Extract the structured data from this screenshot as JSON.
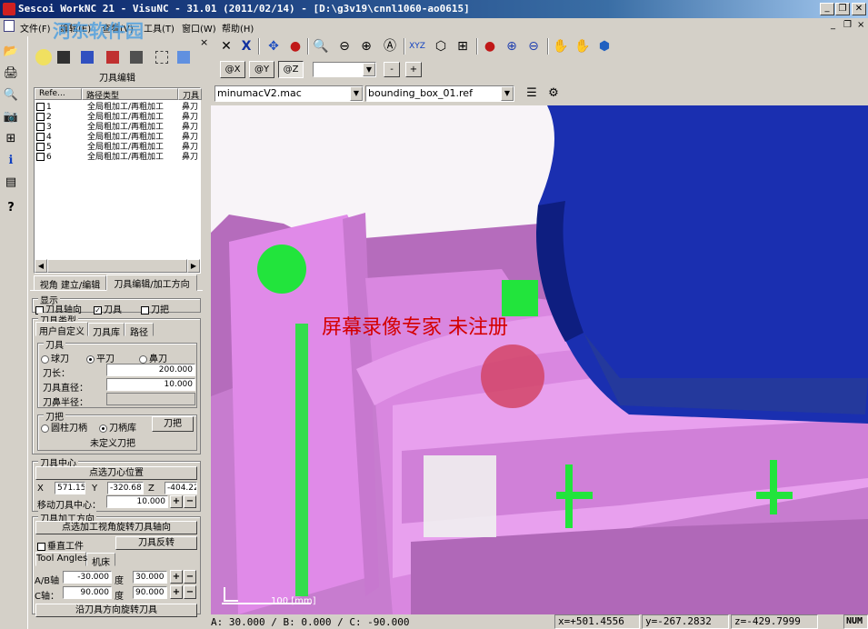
{
  "window": {
    "title": "Sescoi WorkNC 21 - VisuNC - 31.01 (2011/02/14) - [D:\\g3v19\\cnnl1060-ao0615]",
    "watermark": "河东软件园",
    "watermark_url": "www.pc0359.cn",
    "minimize": "_",
    "restore": "❐",
    "close": "✕"
  },
  "menu": {
    "items": [
      "文件(F)",
      "编辑(E)",
      "查看(V)",
      "工具(T)",
      "窗口(W)",
      "帮助(H)"
    ],
    "mdi_min": "_",
    "mdi_restore": "❐",
    "mdi_close": "×"
  },
  "left_toolbar": {
    "icons": [
      "open-icon",
      "print-icon",
      "preview-icon",
      "camera-icon",
      "tree-icon",
      "info-icon",
      "calc-icon",
      "help-icon"
    ],
    "glyphs": [
      "📂",
      "🖨",
      "🔍",
      "📷",
      "⊞",
      "ℹ",
      "▤",
      "?"
    ]
  },
  "panel": {
    "close": "×",
    "title": "刀具编辑",
    "list_headers": [
      "Refe...",
      "路径类型",
      "刀具"
    ],
    "list_rows": [
      {
        "ref": "1",
        "type": "全局粗加工/再粗加工",
        "tool": "鼻刀"
      },
      {
        "ref": "2",
        "type": "全局粗加工/再粗加工",
        "tool": "鼻刀"
      },
      {
        "ref": "3",
        "type": "全局粗加工/再粗加工",
        "tool": "鼻刀"
      },
      {
        "ref": "4",
        "type": "全局粗加工/再粗加工",
        "tool": "鼻刀"
      },
      {
        "ref": "5",
        "type": "全局粗加工/再粗加工",
        "tool": "鼻刀"
      },
      {
        "ref": "6",
        "type": "全局粗加工/再粗加工",
        "tool": "鼻刀"
      }
    ],
    "scroll_left": "◀",
    "scroll_right": "▶",
    "bottom_tabs": [
      "视角 建立/编辑",
      "刀具编辑/加工方向"
    ],
    "display_group": "显示",
    "show_axis": "刀具轴向",
    "show_tool": "刀具",
    "show_holder": "刀把",
    "tool_type_group": "刀具类型",
    "type_tabs": [
      "用户自定义",
      "刀具库",
      "路径"
    ],
    "tool_group": "刀具",
    "ball": "球刀",
    "flat": "平刀",
    "nose": "鼻刀",
    "length_label": "刀长：",
    "length_value": "200.000",
    "diameter_label": "刀具直径：",
    "diameter_value": "10.000",
    "nose_radius_label": "刀鼻半径：",
    "holder_group": "刀把",
    "cyl_holder": "圆柱刀柄",
    "lib_holder": "刀柄库",
    "holder_button": "刀把",
    "undefined_holder": "未定义刀把",
    "center_group": "刀具中心",
    "pick_center": "点选刀心位置",
    "x_label": "X",
    "x_value": "571.15",
    "y_label": "Y",
    "y_value": "-320.68",
    "z_label": "Z",
    "z_value": "-404.22",
    "move_label": "移动刀具中心：",
    "move_value": "10.000",
    "plus": "+",
    "minus": "−",
    "dir_group": "刀具加工方向",
    "pick_dir": "点选加工视角旋转刀具轴向",
    "vertical": "垂直工件",
    "reverse": "刀具反转",
    "angle_tabs": [
      "Tool Angles",
      "机床"
    ],
    "ab_label": "A/B轴",
    "ab_value": "-30.000",
    "ab_unit": "度",
    "ab_step": "30.000",
    "c_label": "C轴：",
    "c_value": "90.000",
    "c_unit": "度",
    "c_step": "90.000",
    "rotate_button": "沿刀具方向旋转刀具"
  },
  "toolbar": {
    "glyphs": [
      "✕",
      "X",
      "✥",
      "●",
      "🔍",
      "⊖",
      "⊕",
      "Ⓐ",
      "XYZ",
      "⬡",
      "⊞",
      "●",
      "⊕",
      "⊖",
      "✋",
      "✋",
      "⬢"
    ],
    "names": [
      "select-icon",
      "cross-icon",
      "pan-icon",
      "shade-icon",
      "zoom-window-icon",
      "zoom-out-icon",
      "zoom-in-icon",
      "zoom-all-icon",
      "axes-icon",
      "iso-view-icon",
      "grid-icon",
      "material-icon",
      "target-icon",
      "section-icon",
      "hand-icon",
      "grab-icon",
      "box-icon"
    ],
    "views": [
      "@X",
      "@Y",
      "@Z"
    ],
    "minus": "-",
    "plus": "+"
  },
  "filebar": {
    "machine_file": "minumacV2.mac",
    "ref_file": "bounding_box_01.ref"
  },
  "viewport": {
    "overlay_text": "屏幕录像专家 未注册",
    "scale_label": "100 [mm]"
  },
  "status": {
    "angles": "A: 30.000 / B: 0.000 / C: -90.000",
    "x": "x=+501.4556",
    "y": "y=-267.2832",
    "z": "z=-429.7999",
    "num": "NUM"
  },
  "colors": {
    "title_bar": "#0a246a",
    "part_pink": "#e08ae8",
    "part_green": "#22e43c",
    "spindle_blue": "#1a2fb0",
    "viewport_overlay_red": "#d40000"
  }
}
